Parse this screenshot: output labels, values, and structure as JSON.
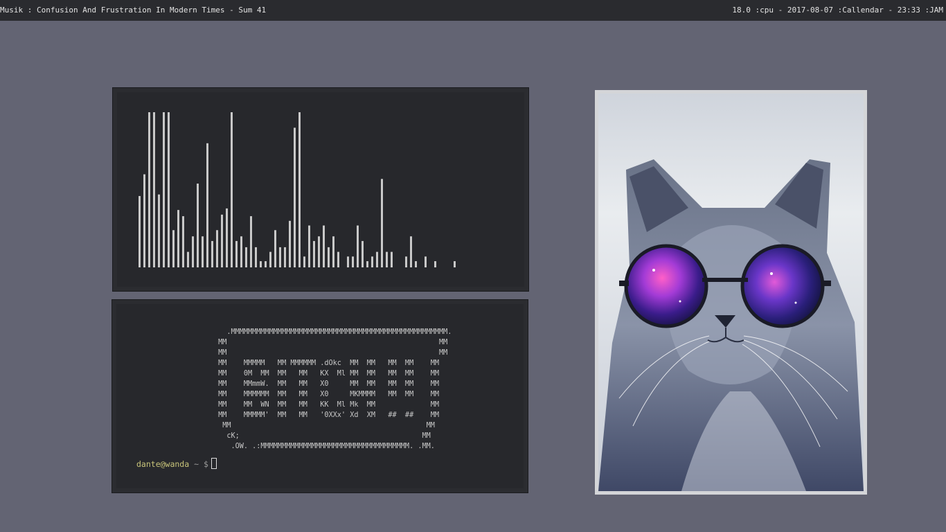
{
  "topbar": {
    "left_text": "Musik : Confusion And Frustration In Modern Times - Sum 41",
    "right_text": "18.0 :cpu - 2017-08-07 :Callendar - 23:33 :JAM"
  },
  "visualizer": {
    "bar_color": "#c9c9c9",
    "bars": [
      {
        "i": 0,
        "h": 0.46
      },
      {
        "i": 1,
        "h": 0.6
      },
      {
        "i": 2,
        "h": 1.0
      },
      {
        "i": 3,
        "h": 1.0
      },
      {
        "i": 4,
        "h": 0.47
      },
      {
        "i": 5,
        "h": 1.0
      },
      {
        "i": 6,
        "h": 1.0
      },
      {
        "i": 7,
        "h": 0.24
      },
      {
        "i": 8,
        "h": 0.37
      },
      {
        "i": 9,
        "h": 0.33
      },
      {
        "i": 10,
        "h": 0.1
      },
      {
        "i": 11,
        "h": 0.2
      },
      {
        "i": 12,
        "h": 0.54
      },
      {
        "i": 13,
        "h": 0.2
      },
      {
        "i": 14,
        "h": 0.8
      },
      {
        "i": 15,
        "h": 0.17
      },
      {
        "i": 16,
        "h": 0.24
      },
      {
        "i": 17,
        "h": 0.34
      },
      {
        "i": 18,
        "h": 0.38
      },
      {
        "i": 19,
        "h": 1.0
      },
      {
        "i": 20,
        "h": 0.17
      },
      {
        "i": 21,
        "h": 0.2
      },
      {
        "i": 22,
        "h": 0.13
      },
      {
        "i": 23,
        "h": 0.33
      },
      {
        "i": 24,
        "h": 0.13
      },
      {
        "i": 25,
        "h": 0.04
      },
      {
        "i": 26,
        "h": 0.04
      },
      {
        "i": 27,
        "h": 0.1
      },
      {
        "i": 28,
        "h": 0.24
      },
      {
        "i": 29,
        "h": 0.13
      },
      {
        "i": 30,
        "h": 0.13
      },
      {
        "i": 31,
        "h": 0.3
      },
      {
        "i": 32,
        "h": 0.9
      },
      {
        "i": 33,
        "h": 1.0
      },
      {
        "i": 34,
        "h": 0.07
      },
      {
        "i": 35,
        "h": 0.27
      },
      {
        "i": 36,
        "h": 0.17
      },
      {
        "i": 37,
        "h": 0.2
      },
      {
        "i": 38,
        "h": 0.27
      },
      {
        "i": 39,
        "h": 0.13
      },
      {
        "i": 40,
        "h": 0.2
      },
      {
        "i": 41,
        "h": 0.1
      },
      {
        "i": 43,
        "h": 0.07
      },
      {
        "i": 44,
        "h": 0.07
      },
      {
        "i": 45,
        "h": 0.27
      },
      {
        "i": 46,
        "h": 0.17
      },
      {
        "i": 47,
        "h": 0.04
      },
      {
        "i": 48,
        "h": 0.07
      },
      {
        "i": 49,
        "h": 0.1
      },
      {
        "i": 50,
        "h": 0.57
      },
      {
        "i": 51,
        "h": 0.1
      },
      {
        "i": 52,
        "h": 0.1
      },
      {
        "i": 55,
        "h": 0.07
      },
      {
        "i": 56,
        "h": 0.2
      },
      {
        "i": 57,
        "h": 0.04
      },
      {
        "i": 59,
        "h": 0.07
      },
      {
        "i": 61,
        "h": 0.04
      },
      {
        "i": 65,
        "h": 0.04
      }
    ]
  },
  "terminal": {
    "ascii_art": "          .MMMMMMMMMMMMMMMMMMMMMMMMMMMMMMMMMMMMMMMMMMMMMMMMMMM.\n        MM                                                  MM\n        MM                                                  MM\n        MM    MMMMM   MM MMMMMM .dOkc  MM  MM   MM  MM    MM\n        MM    0M  MM  MM   MM   KX  Ml MM  MM   MM  MM    MM\n        MM    MMmmW.  MM   MM   X0     MM  MM   MM  MM    MM\n        MM    MMMMMM  MM   MM   X0     MKMMMM   MM  MM    MM\n        MM    MM  WN  MM   MM   KK  Ml Mk  MM             MM\n        MM    MMMMM'  MM   MM   '0XXx' Xd  XM   ##  ##    MM\n         MM                                              MM\n          cK;                                           MM\n           .OW. .:MMMMMMMMMMMMMMMMMMMMMMMMMMMMMMMMMMM. .MM.",
    "prompt_user": "dante@wanda",
    "prompt_path": "~",
    "prompt_symbol": "$"
  },
  "wallpaper": {
    "subject": "cat-with-galaxy-sunglasses"
  },
  "colors": {
    "desktop_bg": "#636473",
    "bar_bg": "#2a2b2f",
    "terminal_bg": "#27282c",
    "prompt_user": "#c8c47a"
  }
}
